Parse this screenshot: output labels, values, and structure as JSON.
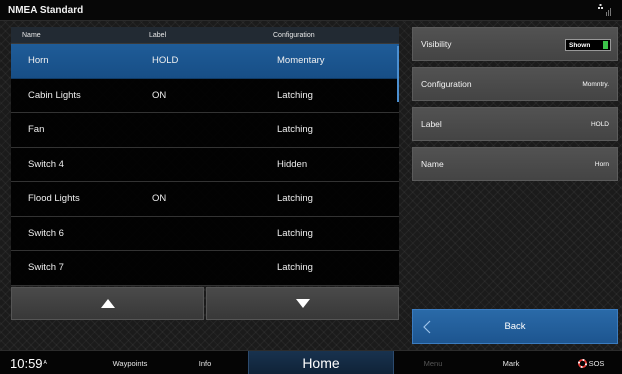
{
  "window": {
    "title": "NMEA Standard"
  },
  "table": {
    "headers": [
      "Name",
      "Label",
      "Configuration"
    ],
    "rows": [
      {
        "name": "Horn",
        "label": "HOLD",
        "configuration": "Momentary",
        "selected": true
      },
      {
        "name": "Cabin Lights",
        "label": "ON",
        "configuration": "Latching"
      },
      {
        "name": "Fan",
        "label": "",
        "configuration": "Latching"
      },
      {
        "name": "Switch 4",
        "label": "",
        "configuration": "Hidden"
      },
      {
        "name": "Flood Lights",
        "label": "ON",
        "configuration": "Latching"
      },
      {
        "name": "Switch 6",
        "label": "",
        "configuration": "Latching"
      },
      {
        "name": "Switch 7",
        "label": "",
        "configuration": "Latching"
      }
    ]
  },
  "nav": {
    "up_icon": "triangle-up-icon",
    "down_icon": "triangle-down-icon"
  },
  "details": {
    "visibility": {
      "title": "Visibility",
      "value": "Shown",
      "toggle_color": "#3cc24a"
    },
    "configuration": {
      "title": "Configuration",
      "value": "Momntry."
    },
    "label": {
      "title": "Label",
      "value": "HOLD"
    },
    "name": {
      "title": "Name",
      "value": "Horn"
    }
  },
  "back": {
    "label": "Back",
    "icon": "chevron-left-icon"
  },
  "bottombar": {
    "time": "10:59",
    "time_suffix": "A",
    "waypoints": "Waypoints",
    "info": "Info",
    "home": "Home",
    "menu": "Menu",
    "mark": "Mark",
    "sos": "SOS"
  },
  "colors": {
    "selected": "#1f5c98",
    "accent": "#2a6aa8",
    "sos": "#e53935"
  }
}
